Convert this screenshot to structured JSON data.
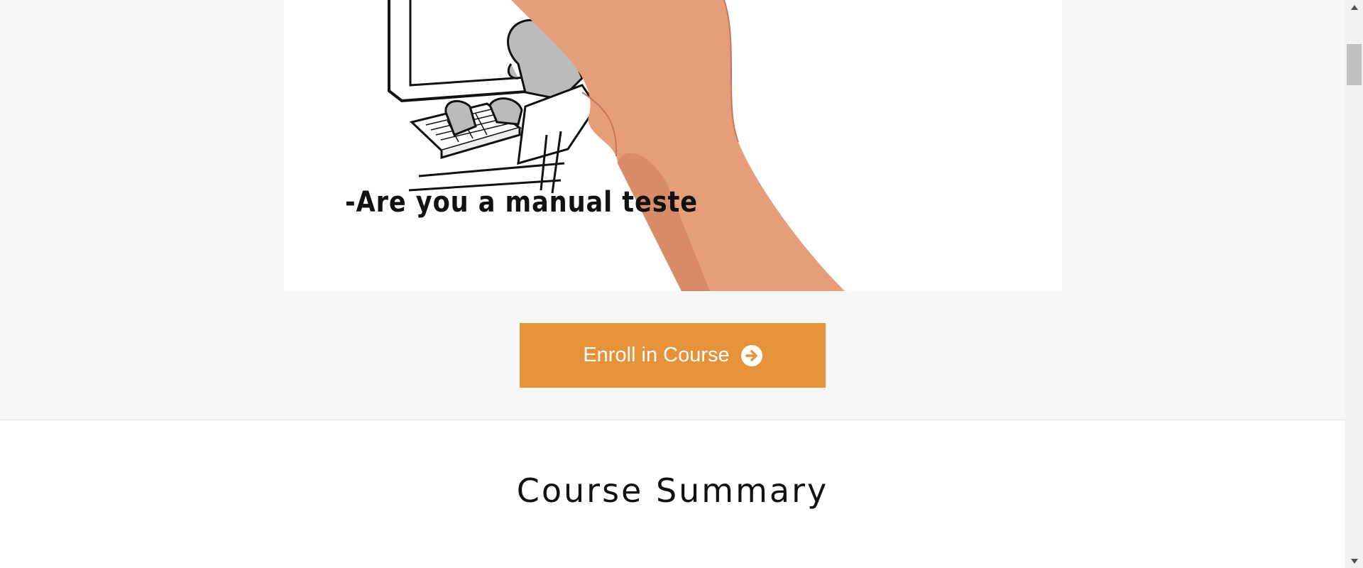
{
  "video": {
    "caption": "-Are you a manual teste"
  },
  "enroll": {
    "label": "Enroll in Course",
    "color": "#e69239"
  },
  "summary": {
    "title": "Course Summary"
  },
  "icons": {
    "enroll_arrow": "arrow-circle-right-icon",
    "scroll_up": "scroll-up-arrow-icon",
    "scroll_down": "scroll-down-arrow-icon"
  }
}
